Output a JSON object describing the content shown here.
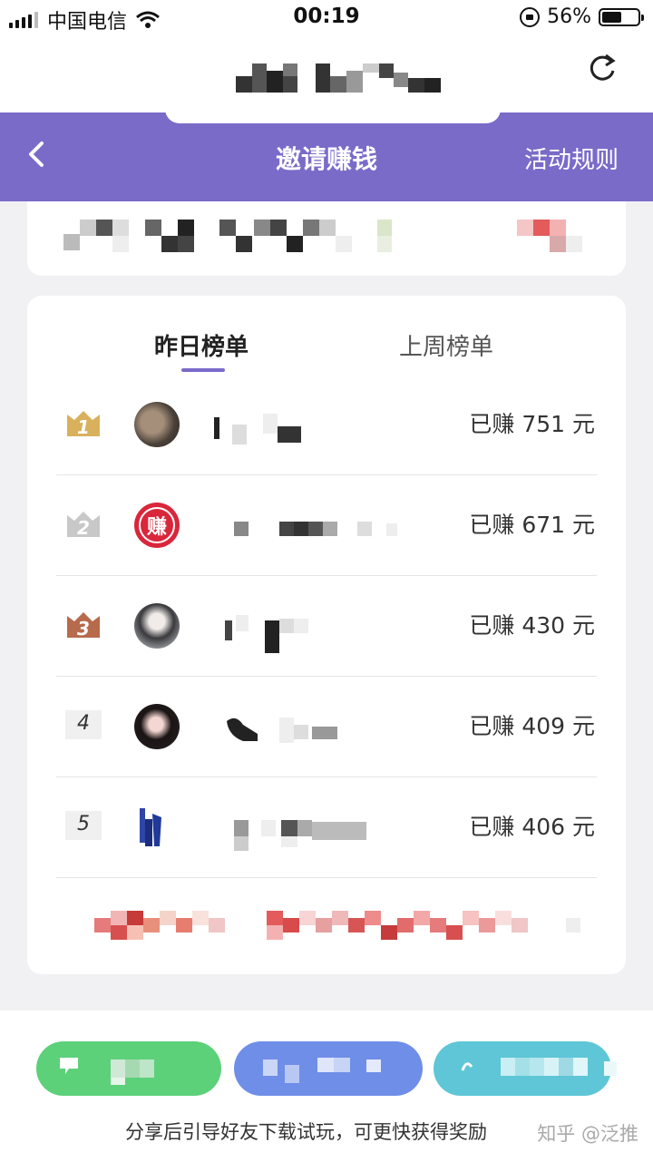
{
  "status_bar": {
    "carrier": "中国电信",
    "time": "00:19",
    "battery_percent": "56%",
    "battery_level": 0.56
  },
  "header": {
    "title": "邀请赚钱",
    "rules": "活动规则"
  },
  "tabs": {
    "yesterday": "昨日榜单",
    "last_week": "上周榜单"
  },
  "ranking": [
    {
      "rank": "1",
      "earned": "已赚 751 元"
    },
    {
      "rank": "2",
      "earned": "已赚 671 元",
      "avatar_text": "赚"
    },
    {
      "rank": "3",
      "earned": "已赚 430 元"
    },
    {
      "rank": "4",
      "earned": "已赚 409 元"
    },
    {
      "rank": "5",
      "earned": "已赚 406 元"
    }
  ],
  "footer": {
    "hint": "分享后引导好友下载试玩，可更快获得奖励",
    "watermark": "知乎 @泛推"
  },
  "colors": {
    "brand_purple": "#7a6bc9",
    "gold": "#d9b15c",
    "silver": "#c8c8c8",
    "bronze": "#b86a4c",
    "share_green": "#5dd07a",
    "share_blue": "#6f8ee8",
    "share_cyan": "#5ec6d6"
  },
  "icons": [
    "signal-icon",
    "wifi-icon",
    "rotation-lock-icon",
    "battery-icon",
    "refresh-icon",
    "back-arrow-icon",
    "crown-icon"
  ]
}
